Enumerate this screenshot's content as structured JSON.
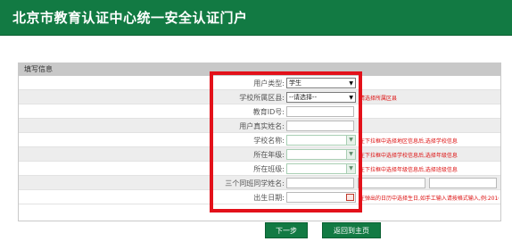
{
  "header": {
    "title": "北京市教育认证中心统一安全认证门户"
  },
  "panel": {
    "title": "填写信息"
  },
  "form": {
    "user_type": {
      "label": "用户类型:",
      "value": "学生"
    },
    "district": {
      "label": "学校所属区县:",
      "value": "--请选择--",
      "hint": "请选择所属区县"
    },
    "edu_id": {
      "label": "教育ID号:",
      "value": ""
    },
    "real_name": {
      "label": "用户真实姓名:",
      "value": ""
    },
    "school": {
      "label": "学校名称:",
      "value": "",
      "hint": "在下拉框中选择地区信息后,选择学校信息"
    },
    "grade": {
      "label": "所在年级:",
      "value": "",
      "hint": "在下拉框中选择学校信息后,选择年级信息"
    },
    "class": {
      "label": "所在班级:",
      "value": "",
      "hint": "在下拉框中选择年级信息后,选择班级信息"
    },
    "classmates": {
      "label": "三个同班同学姓名:",
      "values": [
        "",
        "",
        ""
      ]
    },
    "birthday": {
      "label": "出生日期:",
      "value": "",
      "hint": "在弹出的日历中选择生日,如手工输入请按格式输入,例:2016-"
    }
  },
  "buttons": {
    "next": "下一步",
    "home": "返回到主页"
  },
  "colors": {
    "brand": "#127a43",
    "hint": "#dd1111",
    "highlight": "#e3111a"
  }
}
